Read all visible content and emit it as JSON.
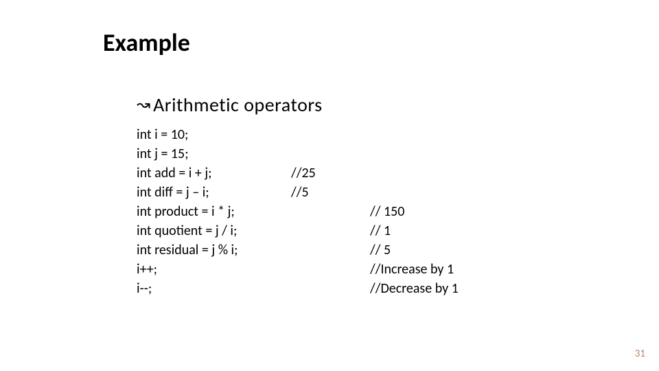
{
  "title": "Example",
  "bullet": "Arithmetic operators",
  "code": {
    "rows": [
      {
        "a": "int i = 10;",
        "b": "",
        "c": ""
      },
      {
        "a": "int j = 15;",
        "b": "",
        "c": ""
      },
      {
        "a": "int add = i + j;",
        "b": "//25",
        "c": ""
      },
      {
        "a": "int diff = j – i;",
        "b": "//5",
        "c": ""
      },
      {
        "a": "int product = i * j;",
        "b": "",
        "c": "// 150"
      },
      {
        "a": "int quotient = j / i;",
        "b": "",
        "c": "// 1"
      },
      {
        "a": "int residual = j % i;",
        "b": "",
        "c": "// 5"
      },
      {
        "a": "i++;",
        "b": "",
        "c": "//Increase by 1"
      },
      {
        "a": "i--;",
        "b": "",
        "c": "//Decrease by 1"
      }
    ]
  },
  "page_number": "31"
}
